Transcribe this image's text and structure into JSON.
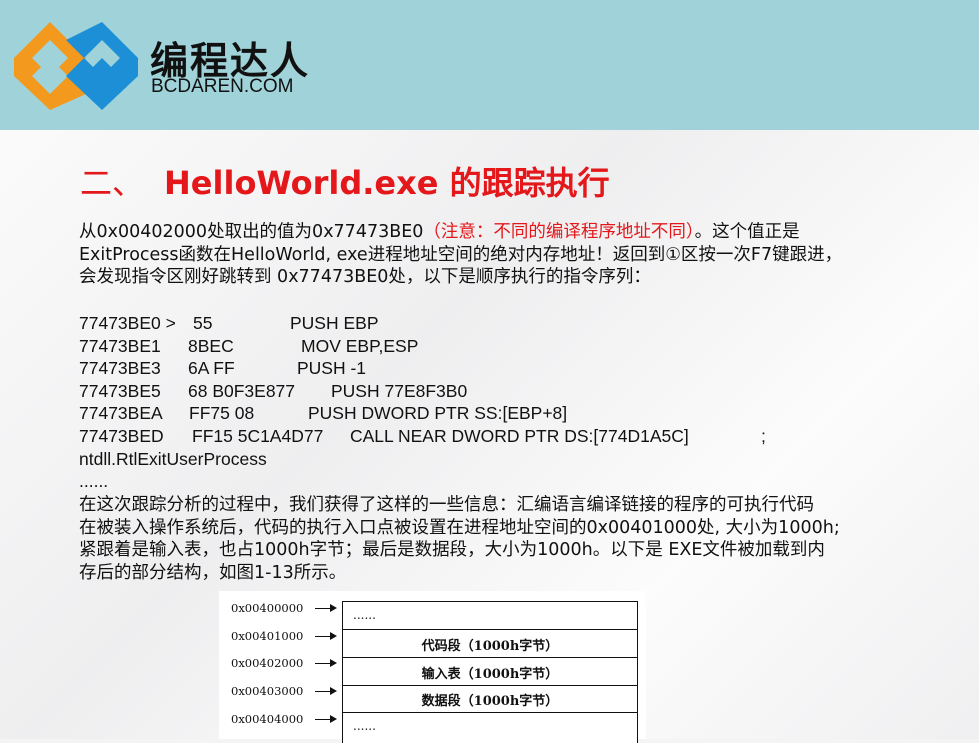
{
  "header": {
    "brand_cn": "编程达人",
    "brand_en": "BCDAREN.COM"
  },
  "title": {
    "number": "二、",
    "text": "HelloWorld.exe 的跟踪执行"
  },
  "paragraph1": {
    "part1": "从0x00402000处取出的值为0x77473BE0",
    "note": "（注意：不同的编译程序地址不同）",
    "part2": "。这个值正是",
    "line2": "ExitProcess函数在HelloWorld, exe进程地址空间的绝对内存地址！返回到①区按一次F7键跟进，",
    "line3": "会发现指令区刚好跳转到 0x77473BE0处，以下是顺序执行的指令序列："
  },
  "code_lines": [
    {
      "addr": "77473BE0 >",
      "bytes": "55",
      "instr": "PUSH EBP"
    },
    {
      "addr": "77473BE1",
      "bytes": "8BEC",
      "instr": "MOV EBP,ESP"
    },
    {
      "addr": "77473BE3",
      "bytes": "6A FF",
      "instr": "PUSH -1"
    },
    {
      "addr": "77473BE5",
      "bytes": "68 B0F3E877",
      "instr": "PUSH 77E8F3B0"
    },
    {
      "addr": "77473BEA",
      "bytes": "FF75 08",
      "instr": "PUSH DWORD PTR SS:[EBP+8]"
    },
    {
      "addr": "77473BED",
      "bytes": "FF15 5C1A4D77",
      "instr": "CALL NEAR DWORD PTR DS:[774D1A5C]",
      "comment": ";"
    }
  ],
  "code_tail": {
    "line": "ntdll.RtlExitUserProcess",
    "ellipsis": "......"
  },
  "paragraph2": {
    "line1": "在这次跟踪分析的过程中，我们获得了这样的一些信息：汇编语言编译链接的程序的可执行代码",
    "line2": "在被装入操作系统后，代码的执行入口点被设置在进程地址空间的0x00401000处, 大小为1000h;",
    "line3": "紧跟着是输入表，也占1000h字节；最后是数据段，大小为1000h。以下是 EXE文件被加载到内",
    "line4": "存后的部分结构，如图1-13所示。"
  },
  "figure": {
    "addresses": [
      "0x00400000",
      "0x00401000",
      "0x00402000",
      "0x00403000",
      "0x00404000"
    ],
    "top_dots": "......",
    "segments": [
      "代码段（1000h字节）",
      "输入表（1000h字节）",
      "数据段（1000h字节）"
    ],
    "bottom_dots": "......"
  }
}
